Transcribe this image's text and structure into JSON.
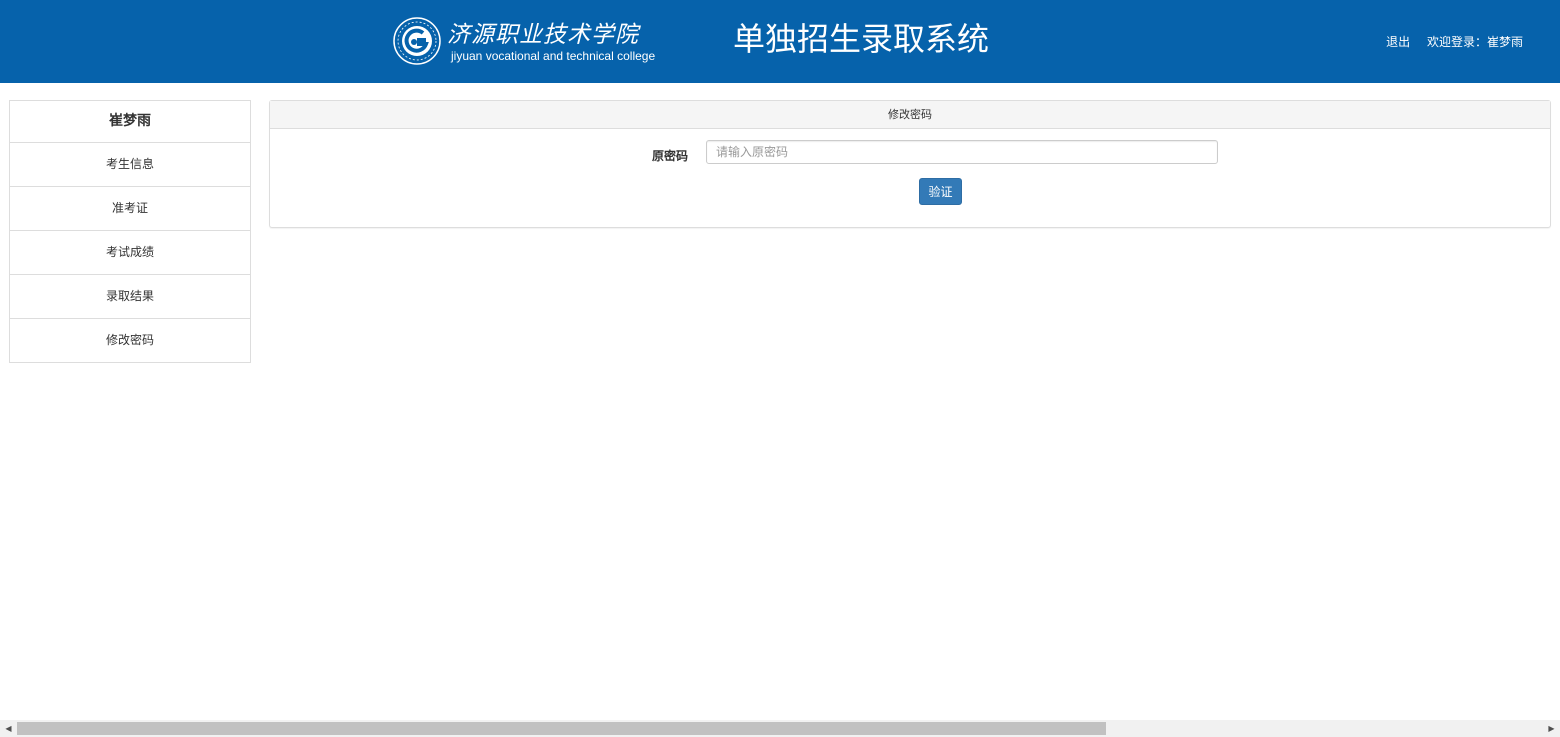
{
  "header": {
    "logo_cn": "济源职业技术学院",
    "logo_en": "jiyuan vocational and technical college",
    "title": "单独招生录取系统",
    "logout_label": "退出",
    "welcome_text": "欢迎登录：崔梦雨",
    "background_color": "#0662ab"
  },
  "sidebar": {
    "user_name": "崔梦雨",
    "items": [
      {
        "label": "考生信息"
      },
      {
        "label": "准考证"
      },
      {
        "label": "考试成绩"
      },
      {
        "label": "录取结果"
      },
      {
        "label": "修改密码"
      }
    ]
  },
  "panel": {
    "heading": "修改密码",
    "field_label": "原密码",
    "input_value": "",
    "input_placeholder": "请输入原密码",
    "verify_button_label": "验证",
    "button_color": "#337ab7"
  },
  "scrollbar": {
    "left_arrow_icon": "arrow-left-icon",
    "right_arrow_icon": "arrow-right-icon"
  }
}
